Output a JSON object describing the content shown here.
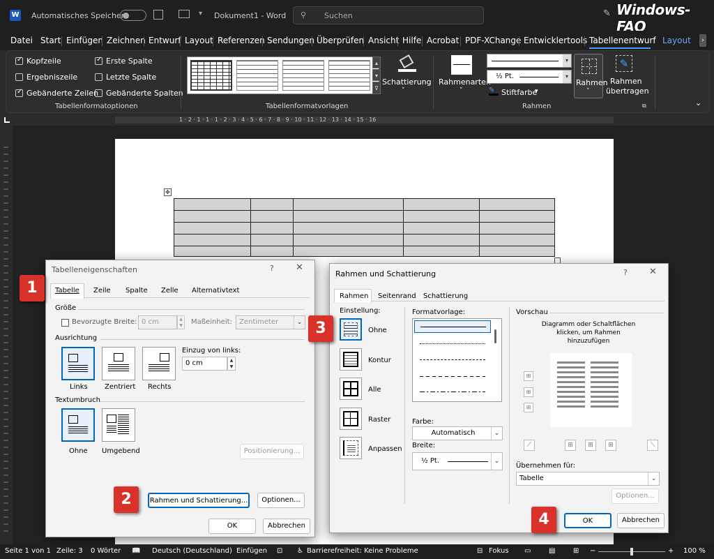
{
  "titlebar": {
    "autosave_label": "Automatisches Speichern",
    "doc_title": "Dokument1 - Word",
    "search_placeholder": "Suchen",
    "watermark": "Windows-FAQ"
  },
  "menu": [
    "Datei",
    "Start",
    "Einfügen",
    "Zeichnen",
    "Entwurf",
    "Layout",
    "Referenzen",
    "Sendungen",
    "Überprüfen",
    "Ansicht",
    "Hilfe",
    "Acrobat",
    "PDF-XChange",
    "Entwicklertools",
    "Tabellenentwurf",
    "Layout"
  ],
  "ribbon": {
    "options": {
      "kopfzeile": "Kopfzeile",
      "ergebniszeile": "Ergebniszeile",
      "gebaenderte_zeilen": "Gebänderte Zeilen",
      "erste_spalte": "Erste Spalte",
      "letzte_spalte": "Letzte Spalte",
      "gebaenderte_spalten": "Gebänderte Spalten",
      "group": "Tabellenformatoptionen"
    },
    "styles_group": "Tabellenformatvorlagen",
    "schattierung": "Schattierung",
    "rahmenarten": "Rahmenarten",
    "pen_weight": "½ Pt.",
    "stiftfarbe": "Stiftfarbe",
    "rahmen": "Rahmen",
    "rahmen_uebertragen_1": "Rahmen",
    "rahmen_uebertragen_2": "übertragen",
    "rahmen_group": "Rahmen"
  },
  "ruler": "1 · 2 · 1 · 1 · 1 · 2 · 3 · 4 · 5 · 6 · 7 · 8 · 9 · 10 · 11 · 12 · 13 · 14 · 15 · 16",
  "dialog1": {
    "title": "Tabelleneigenschaften",
    "tabs": [
      "Tabelle",
      "Zeile",
      "Spalte",
      "Zelle",
      "Alternativtext"
    ],
    "groesse": "Größe",
    "bevorzugte_breite": "Bevorzugte Breite:",
    "breite_value": "0 cm",
    "masseinheit": "Maßeinheit:",
    "masseinheit_value": "Zentimeter",
    "ausrichtung": "Ausrichtung",
    "align": [
      "Links",
      "Zentriert",
      "Rechts"
    ],
    "einzug": "Einzug von links:",
    "einzug_value": "0 cm",
    "textumbruch": "Textumbruch",
    "wrap": [
      "Ohne",
      "Umgebend"
    ],
    "positionierung": "Positionierung...",
    "rahmen_btn": "Rahmen und Schattierung...",
    "optionen_btn": "Optionen...",
    "ok": "OK",
    "abbrechen": "Abbrechen"
  },
  "dialog2": {
    "title": "Rahmen und Schattierung",
    "tabs": [
      "Rahmen",
      "Seitenrand",
      "Schattierung"
    ],
    "einstellung": "Einstellung:",
    "settings": [
      "Ohne",
      "Kontur",
      "Alle",
      "Raster",
      "Anpassen"
    ],
    "formatvorlage": "Formatvorlage:",
    "farbe": "Farbe:",
    "farbe_value": "Automatisch",
    "breite": "Breite:",
    "breite_value": "½ Pt.",
    "vorschau": "Vorschau",
    "vorschau_hint": "Diagramm oder Schaltflächen klicken, um Rahmen hinzuzufügen",
    "uebernehmen": "Übernehmen für:",
    "uebernehmen_value": "Tabelle",
    "optionen": "Optionen...",
    "ok": "OK",
    "abbrechen": "Abbrechen"
  },
  "badges": [
    "1",
    "2",
    "3",
    "4"
  ],
  "status": {
    "seite": "Seite 1 von 1",
    "zeile": "Zeile: 3",
    "woerter": "0 Wörter",
    "sprache": "Deutsch (Deutschland)",
    "einfuegen": "Einfügen",
    "barriere": "Barrierefreiheit: Keine Probleme",
    "fokus": "Fokus",
    "zoom": "100 %"
  }
}
